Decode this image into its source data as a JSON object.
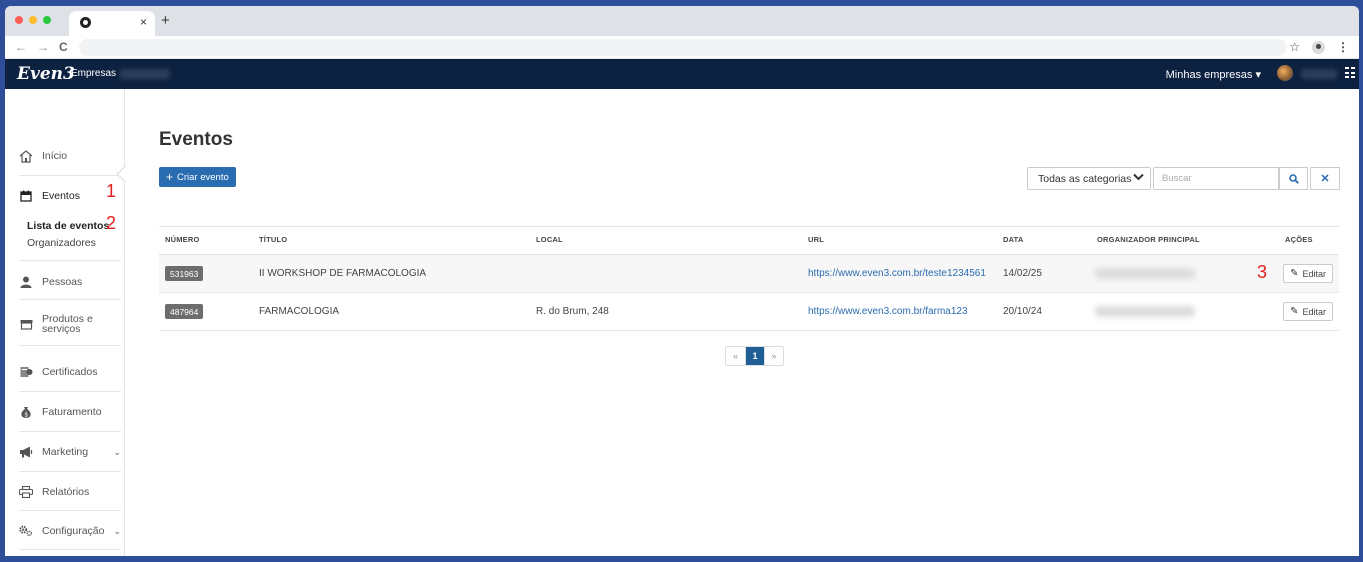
{
  "browser": {
    "tab_close": "×",
    "new_tab": "+",
    "back": "←",
    "forward": "→",
    "reload": "C"
  },
  "appbar": {
    "logo": "Even3",
    "logo_sub": "Empresas",
    "my_companies": "Minhas empresas ▾"
  },
  "sidebar": {
    "items": [
      {
        "label": "Início",
        "icon": "home-icon"
      },
      {
        "label": "Eventos",
        "icon": "calendar-icon"
      },
      {
        "label": "Pessoas",
        "icon": "person-icon"
      },
      {
        "label": "Produtos e serviços",
        "icon": "store-icon"
      },
      {
        "label": "Certificados",
        "icon": "certificate-icon"
      },
      {
        "label": "Faturamento",
        "icon": "money-bag-icon"
      },
      {
        "label": "Marketing",
        "icon": "megaphone-icon"
      },
      {
        "label": "Relatórios",
        "icon": "printer-icon"
      },
      {
        "label": "Configuração",
        "icon": "gear-icon"
      }
    ],
    "sub_items": [
      "Lista de eventos",
      "Organizadores"
    ]
  },
  "annotations": [
    "1",
    "2",
    "3"
  ],
  "main": {
    "title": "Eventos",
    "create_button": "Criar evento",
    "category_select": "Todas as categorias",
    "search_placeholder": "Buscar",
    "table": {
      "headers": [
        "NÚMERO",
        "TÍTULO",
        "LOCAL",
        "URL",
        "DATA",
        "ORGANIZADOR PRINCIPAL",
        "AÇÕES"
      ],
      "rows": [
        {
          "number": "531963",
          "title": "II WORKSHOP DE FARMACOLOGIA",
          "local": "",
          "url": "https://www.even3.com.br/teste1234561",
          "date": "14/02/25",
          "action": "Editar"
        },
        {
          "number": "487964",
          "title": "FARMACOLOGIA",
          "local": "R. do Brum, 248",
          "url": "https://www.even3.com.br/farma123",
          "date": "20/10/24",
          "action": "Editar"
        }
      ]
    },
    "pagination": {
      "prev": "«",
      "current": "1",
      "next": "»"
    }
  },
  "colors": {
    "primary": "#2a6cb0",
    "header": "#0d2240",
    "annotation": "#e3201b"
  }
}
